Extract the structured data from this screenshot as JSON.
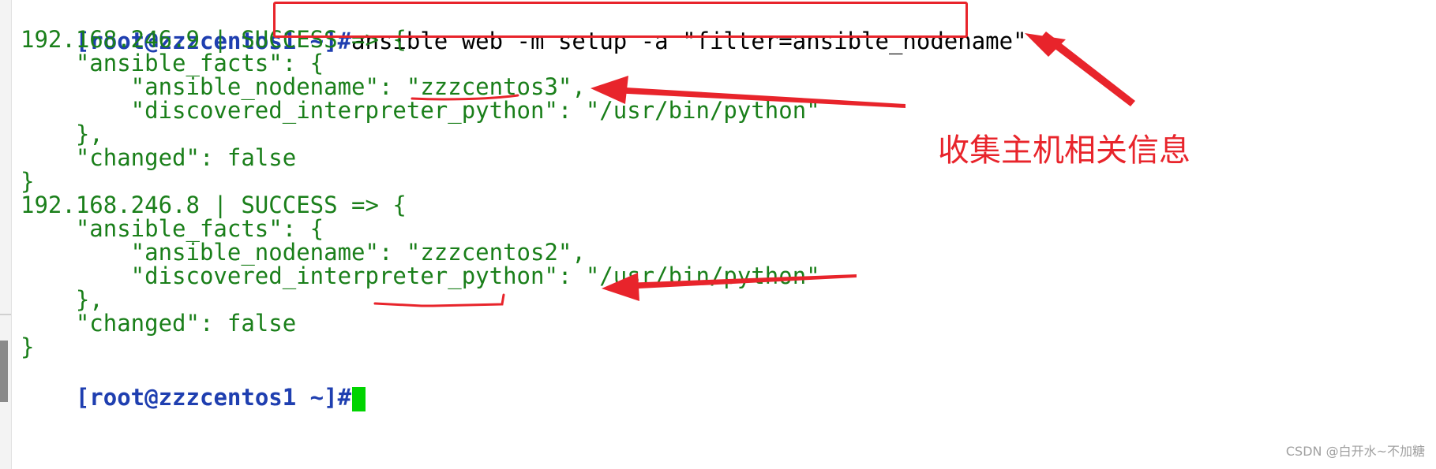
{
  "terminal": {
    "prompt_1": "[root@zzzcentos1 ~]#",
    "command_1": "ansible web -m setup -a \"filter=ansible_nodename\"",
    "lines": [
      "192.168.246.9 | SUCCESS => {",
      "    \"ansible_facts\": {",
      "        \"ansible_nodename\": \"zzzcentos3\",",
      "        \"discovered_interpreter_python\": \"/usr/bin/python\"",
      "    },",
      "    \"changed\": false",
      "}",
      "192.168.246.8 | SUCCESS => {",
      "    \"ansible_facts\": {",
      "        \"ansible_nodename\": \"zzzcentos2\",",
      "        \"discovered_interpreter_python\": \"/usr/bin/python\"",
      "    },",
      "    \"changed\": false",
      "}"
    ],
    "prompt_2": "[root@zzzcentos1 ~]#"
  },
  "annotation": {
    "label": "收集主机相关信息"
  },
  "watermark": "CSDN @白开水~不加糖",
  "colors": {
    "output_green": "#1a7f1a",
    "prompt_blue": "#1f3fb0",
    "annotation_red": "#e8242b",
    "cursor_green": "#00d400"
  }
}
